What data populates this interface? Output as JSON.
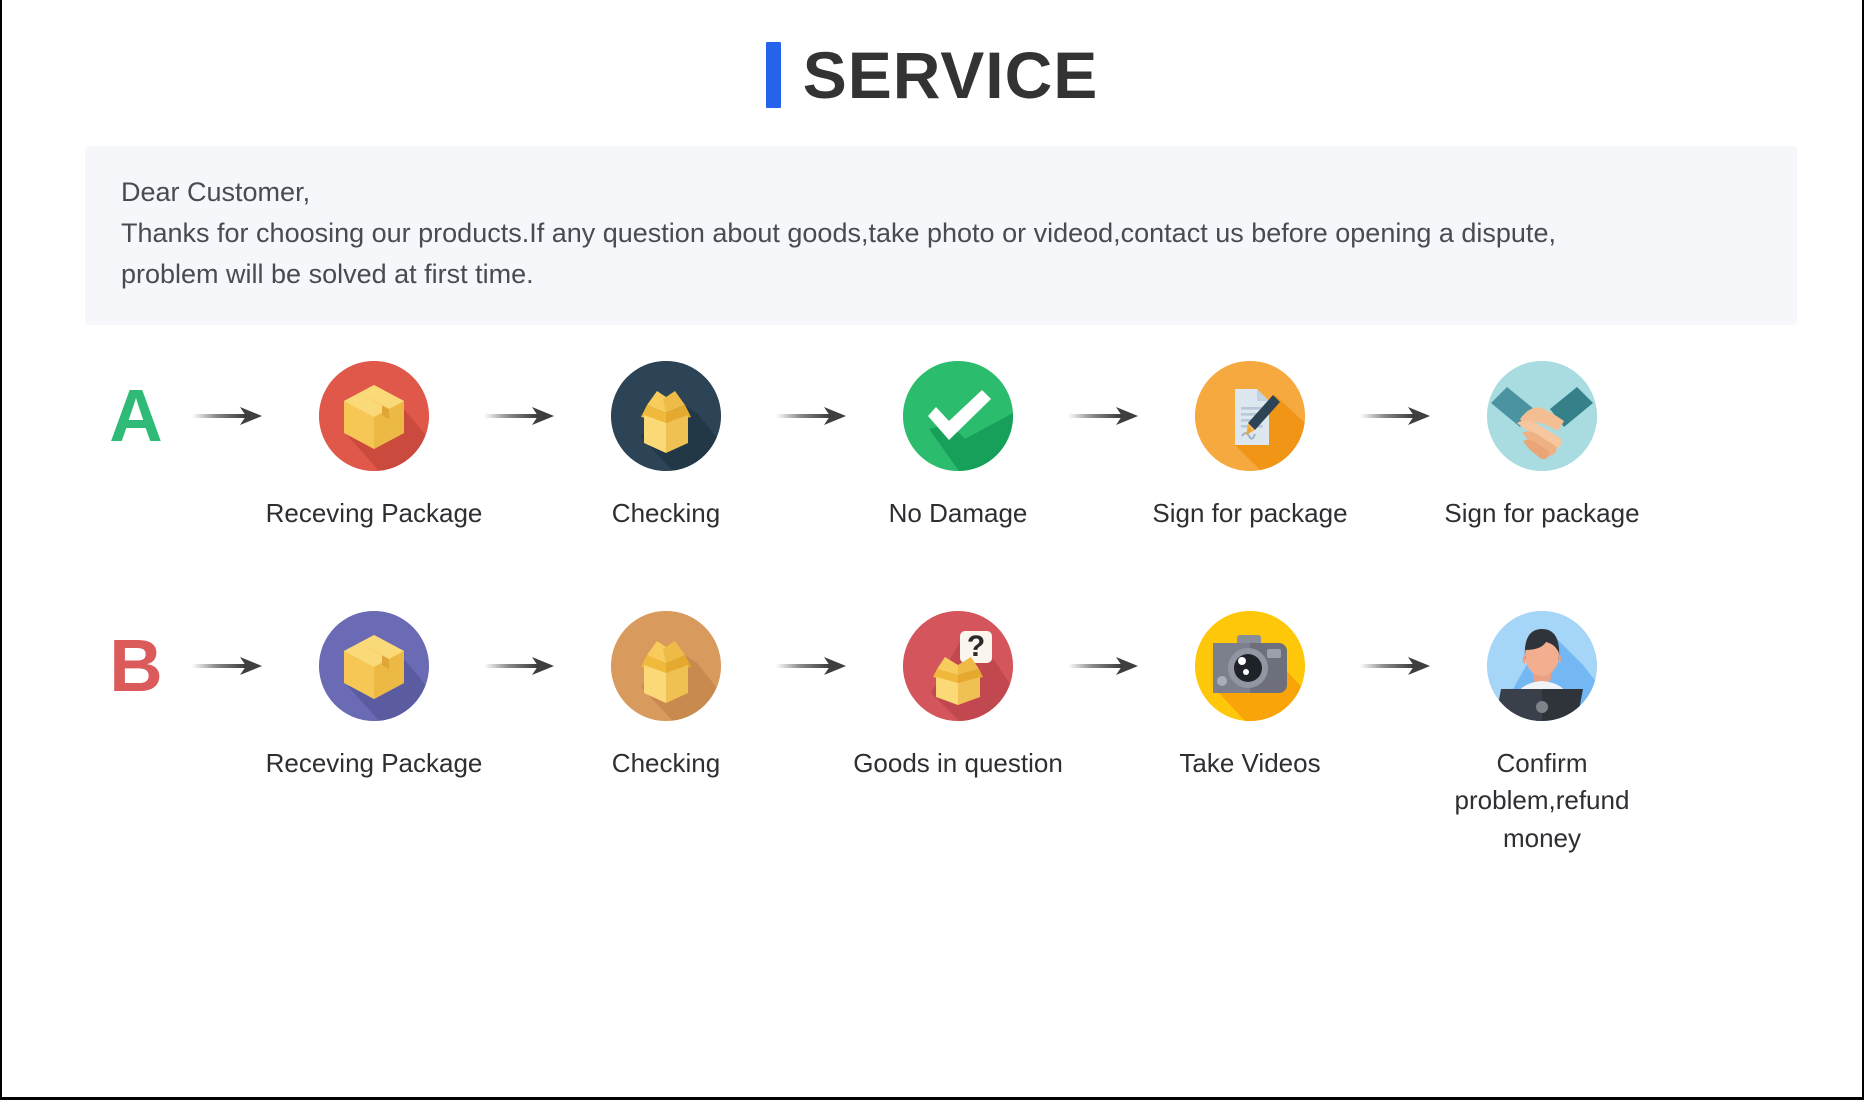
{
  "header": {
    "accent_color": "#2563EB",
    "title": "SERVICE"
  },
  "notice": {
    "line1": "Dear Customer,",
    "line2": "Thanks for choosing our products.If any question about goods,take photo or videod,contact us before opening a dispute,",
    "line3": "problem will be solved at first time.",
    "background_color": "#F5F7FA"
  },
  "flows": [
    {
      "badge": "A",
      "badge_color": "#2FBB77",
      "steps": [
        {
          "label": "Receving Package",
          "icon": "package-box-icon",
          "circle_color": "#E0584A"
        },
        {
          "label": "Checking",
          "icon": "open-box-icon",
          "circle_color": "#2C4455"
        },
        {
          "label": "No Damage",
          "icon": "checkmark-icon",
          "circle_color": "#2BBC6E"
        },
        {
          "label": "Sign for package",
          "icon": "document-pen-icon",
          "circle_color": "#F5A93F"
        },
        {
          "label": "Sign for package",
          "icon": "handshake-icon",
          "circle_color": "#A9DCE1"
        }
      ]
    },
    {
      "badge": "B",
      "badge_color": "#DB5A5A",
      "steps": [
        {
          "label": "Receving Package",
          "icon": "package-box-icon",
          "circle_color": "#6A6BB4"
        },
        {
          "label": "Checking",
          "icon": "open-box-icon",
          "circle_color": "#D99A5E"
        },
        {
          "label": "Goods in question",
          "icon": "question-box-icon",
          "circle_color": "#D4565C"
        },
        {
          "label": "Take Videos",
          "icon": "camera-icon",
          "circle_color": "#FFC709"
        },
        {
          "label": "Confirm problem,refund money",
          "icon": "support-agent-icon",
          "circle_color": "#A5D5F7"
        }
      ]
    }
  ],
  "arrow": {
    "name": "arrow-right-icon"
  }
}
